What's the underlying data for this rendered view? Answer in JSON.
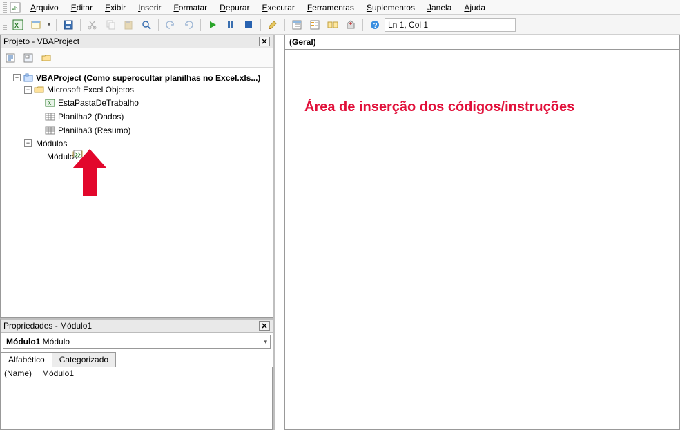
{
  "menu": {
    "items": [
      {
        "u": "A",
        "rest": "rquivo"
      },
      {
        "u": "E",
        "rest": "ditar"
      },
      {
        "u": "E",
        "rest": "xibir"
      },
      {
        "u": "I",
        "rest": "nserir"
      },
      {
        "u": "F",
        "rest": "ormatar"
      },
      {
        "u": "D",
        "rest": "epurar"
      },
      {
        "u": "E",
        "rest": "xecutar"
      },
      {
        "u": "F",
        "rest": "erramentas"
      },
      {
        "u": "S",
        "rest": "uplementos"
      },
      {
        "u": "J",
        "rest": "anela"
      },
      {
        "u": "A",
        "rest": "juda"
      }
    ]
  },
  "toolbar": {
    "position_label": "Ln 1, Col 1"
  },
  "project_panel": {
    "title": "Projeto - VBAProject",
    "root": "VBAProject (Como superocultar planilhas no Excel.xls...)",
    "excel_objects": "Microsoft Excel Objetos",
    "items": {
      "workbook": "EstaPastaDeTrabalho",
      "sheet2": "Planilha2 (Dados)",
      "sheet3": "Planilha3 (Resumo)"
    },
    "modules_folder": "Módulos",
    "module1": "Módulo1"
  },
  "props_panel": {
    "title": "Propriedades - Módulo1",
    "object_name": "Módulo1",
    "object_type": "Módulo",
    "tabs": {
      "alpha": "Alfabético",
      "cat": "Categorizado"
    },
    "rows": [
      {
        "key": "(Name)",
        "val": "Módulo1"
      }
    ]
  },
  "code_pane": {
    "scope": "(Geral)",
    "annotation": "Área de inserção dos códigos/instruções"
  }
}
